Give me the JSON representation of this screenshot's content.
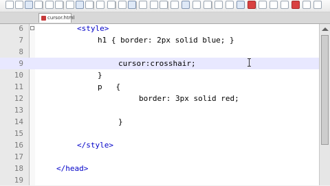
{
  "tab": {
    "label": "cursor.html"
  },
  "editor": {
    "lines": [
      {
        "num": "6",
        "text": "<style>",
        "kind": "tag",
        "indent": 60,
        "fold": true
      },
      {
        "num": "7",
        "text": "h1 { border: 2px solid blue; }",
        "kind": "code",
        "indent": 90
      },
      {
        "num": "8",
        "text": "",
        "kind": "code",
        "indent": 0
      },
      {
        "num": "9",
        "text": "cursor:crosshair;",
        "kind": "code",
        "indent": 120,
        "current": true
      },
      {
        "num": "10",
        "text": "}",
        "kind": "code",
        "indent": 90
      },
      {
        "num": "11",
        "text": "p   {",
        "kind": "code",
        "indent": 90
      },
      {
        "num": "12",
        "text": "border: 3px solid red;",
        "kind": "code",
        "indent": 150
      },
      {
        "num": "13",
        "text": "",
        "kind": "code",
        "indent": 0
      },
      {
        "num": "14",
        "text": "}",
        "kind": "code",
        "indent": 120
      },
      {
        "num": "15",
        "text": "",
        "kind": "code",
        "indent": 0
      },
      {
        "num": "16",
        "text": "</style>",
        "kind": "tag",
        "indent": 60
      },
      {
        "num": "17",
        "text": "",
        "kind": "code",
        "indent": 0
      },
      {
        "num": "18",
        "text": "</head>",
        "kind": "tag",
        "indent": 30
      },
      {
        "num": "19",
        "text": "",
        "kind": "code",
        "indent": 0
      }
    ]
  },
  "colors": {
    "tag": "#0000c8",
    "current_line": "#e8e8ff",
    "text": "#000000"
  },
  "icons": {
    "tab": "html-file-icon",
    "mouse": "text-cursor-icon"
  }
}
